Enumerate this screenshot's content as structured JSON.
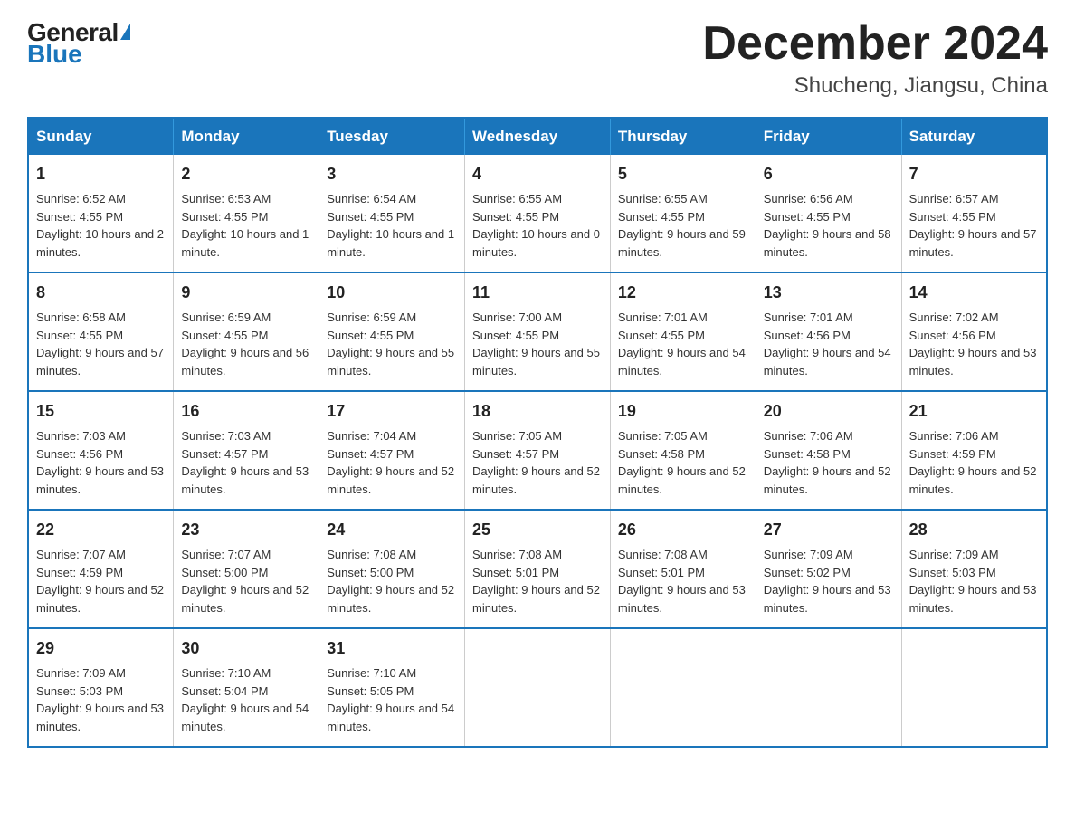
{
  "header": {
    "logo_general": "General",
    "logo_blue": "Blue",
    "month_title": "December 2024",
    "location": "Shucheng, Jiangsu, China"
  },
  "weekdays": [
    "Sunday",
    "Monday",
    "Tuesday",
    "Wednesday",
    "Thursday",
    "Friday",
    "Saturday"
  ],
  "weeks": [
    [
      {
        "day": "1",
        "sunrise": "6:52 AM",
        "sunset": "4:55 PM",
        "daylight": "10 hours and 2 minutes."
      },
      {
        "day": "2",
        "sunrise": "6:53 AM",
        "sunset": "4:55 PM",
        "daylight": "10 hours and 1 minute."
      },
      {
        "day": "3",
        "sunrise": "6:54 AM",
        "sunset": "4:55 PM",
        "daylight": "10 hours and 1 minute."
      },
      {
        "day": "4",
        "sunrise": "6:55 AM",
        "sunset": "4:55 PM",
        "daylight": "10 hours and 0 minutes."
      },
      {
        "day": "5",
        "sunrise": "6:55 AM",
        "sunset": "4:55 PM",
        "daylight": "9 hours and 59 minutes."
      },
      {
        "day": "6",
        "sunrise": "6:56 AM",
        "sunset": "4:55 PM",
        "daylight": "9 hours and 58 minutes."
      },
      {
        "day": "7",
        "sunrise": "6:57 AM",
        "sunset": "4:55 PM",
        "daylight": "9 hours and 57 minutes."
      }
    ],
    [
      {
        "day": "8",
        "sunrise": "6:58 AM",
        "sunset": "4:55 PM",
        "daylight": "9 hours and 57 minutes."
      },
      {
        "day": "9",
        "sunrise": "6:59 AM",
        "sunset": "4:55 PM",
        "daylight": "9 hours and 56 minutes."
      },
      {
        "day": "10",
        "sunrise": "6:59 AM",
        "sunset": "4:55 PM",
        "daylight": "9 hours and 55 minutes."
      },
      {
        "day": "11",
        "sunrise": "7:00 AM",
        "sunset": "4:55 PM",
        "daylight": "9 hours and 55 minutes."
      },
      {
        "day": "12",
        "sunrise": "7:01 AM",
        "sunset": "4:55 PM",
        "daylight": "9 hours and 54 minutes."
      },
      {
        "day": "13",
        "sunrise": "7:01 AM",
        "sunset": "4:56 PM",
        "daylight": "9 hours and 54 minutes."
      },
      {
        "day": "14",
        "sunrise": "7:02 AM",
        "sunset": "4:56 PM",
        "daylight": "9 hours and 53 minutes."
      }
    ],
    [
      {
        "day": "15",
        "sunrise": "7:03 AM",
        "sunset": "4:56 PM",
        "daylight": "9 hours and 53 minutes."
      },
      {
        "day": "16",
        "sunrise": "7:03 AM",
        "sunset": "4:57 PM",
        "daylight": "9 hours and 53 minutes."
      },
      {
        "day": "17",
        "sunrise": "7:04 AM",
        "sunset": "4:57 PM",
        "daylight": "9 hours and 52 minutes."
      },
      {
        "day": "18",
        "sunrise": "7:05 AM",
        "sunset": "4:57 PM",
        "daylight": "9 hours and 52 minutes."
      },
      {
        "day": "19",
        "sunrise": "7:05 AM",
        "sunset": "4:58 PM",
        "daylight": "9 hours and 52 minutes."
      },
      {
        "day": "20",
        "sunrise": "7:06 AM",
        "sunset": "4:58 PM",
        "daylight": "9 hours and 52 minutes."
      },
      {
        "day": "21",
        "sunrise": "7:06 AM",
        "sunset": "4:59 PM",
        "daylight": "9 hours and 52 minutes."
      }
    ],
    [
      {
        "day": "22",
        "sunrise": "7:07 AM",
        "sunset": "4:59 PM",
        "daylight": "9 hours and 52 minutes."
      },
      {
        "day": "23",
        "sunrise": "7:07 AM",
        "sunset": "5:00 PM",
        "daylight": "9 hours and 52 minutes."
      },
      {
        "day": "24",
        "sunrise": "7:08 AM",
        "sunset": "5:00 PM",
        "daylight": "9 hours and 52 minutes."
      },
      {
        "day": "25",
        "sunrise": "7:08 AM",
        "sunset": "5:01 PM",
        "daylight": "9 hours and 52 minutes."
      },
      {
        "day": "26",
        "sunrise": "7:08 AM",
        "sunset": "5:01 PM",
        "daylight": "9 hours and 53 minutes."
      },
      {
        "day": "27",
        "sunrise": "7:09 AM",
        "sunset": "5:02 PM",
        "daylight": "9 hours and 53 minutes."
      },
      {
        "day": "28",
        "sunrise": "7:09 AM",
        "sunset": "5:03 PM",
        "daylight": "9 hours and 53 minutes."
      }
    ],
    [
      {
        "day": "29",
        "sunrise": "7:09 AM",
        "sunset": "5:03 PM",
        "daylight": "9 hours and 53 minutes."
      },
      {
        "day": "30",
        "sunrise": "7:10 AM",
        "sunset": "5:04 PM",
        "daylight": "9 hours and 54 minutes."
      },
      {
        "day": "31",
        "sunrise": "7:10 AM",
        "sunset": "5:05 PM",
        "daylight": "9 hours and 54 minutes."
      },
      null,
      null,
      null,
      null
    ]
  ]
}
